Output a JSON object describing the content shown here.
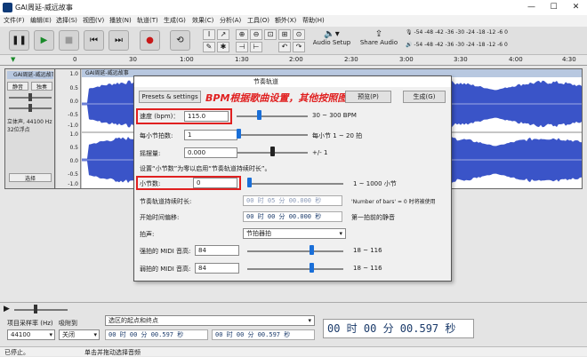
{
  "window": {
    "title": "GAI周延-威远故事"
  },
  "menu": [
    "文件(F)",
    "编辑(E)",
    "选择(S)",
    "视图(V)",
    "播放(N)",
    "轨道(T)",
    "生成(G)",
    "效果(C)",
    "分析(A)",
    "工具(O)",
    "额外(X)",
    "帮助(H)"
  ],
  "toolbar": {
    "audio_setup": "Audio Setup",
    "share_audio": "Share Audio",
    "meter_ticks": "-54 -48 -42 -36 -30 -24 -18 -12 -6 0",
    "meter_ticks2": "-54 -48 -42 -36 -30 -24 -18 -12 -6 0",
    "transport": [
      "pause",
      "play",
      "stop",
      "skip-start",
      "skip-end",
      "record",
      "loop"
    ]
  },
  "ruler": {
    "ticks": [
      "0",
      "30",
      "1:00",
      "1:30",
      "2:00",
      "2:30",
      "3:00",
      "3:30",
      "4:00",
      "4:30"
    ]
  },
  "track": {
    "name": "GAI周延-威远故事",
    "clip_name": "GAI周延-威远故事",
    "mute": "静音",
    "solo": "独奏",
    "info": "立体声, 44100 Hz\n32位浮点",
    "select": "选择",
    "scale": [
      "1.0",
      "0.5",
      "0.0",
      "-0.5",
      "-1.0",
      "1.0",
      "0.5",
      "0.0",
      "-0.5",
      "-1.0"
    ]
  },
  "dialog": {
    "title": "节奏轨道",
    "presets_label": "Presets & settings",
    "preview_label": "预览(P)",
    "generate_label": "生成(G)",
    "annotation": "BPM根据歌曲设置，其他按照图设置",
    "tempo_label": "速度 (bpm)：",
    "tempo_value": "115.0",
    "tempo_range": "30 ~ 300 BPM",
    "tempo_level": 0.3,
    "beats_label": "每小节拍数:",
    "beats_value": "1",
    "beats_range": "每小节 1 ~ 20 拍",
    "beats_level": 0.0,
    "swing_label": "摇摆量:",
    "swing_value": "0.000",
    "swing_range": "+/- 1",
    "swing_level": 0.5,
    "hint": "设置“小节数”为零以启用“节奏轨道持续时长”。",
    "bars_label": "小节数:",
    "bars_value": "0",
    "bars_range": "1 ~ 1000 小节",
    "bars_level": 0.0,
    "duration_label": "节奏轨道持续时长:",
    "duration_value": "00 时 05 分 00.000 秒",
    "duration_note": "'Number of bars' = 0 时将被使用",
    "offset_label": "开始时间偏移:",
    "offset_value": "00 时 00 分 00.000 秒",
    "offset_note": "第一拍前的静音",
    "beat_sound_label": "拍声:",
    "beat_sound_value": "节拍器拍",
    "strong_label": "强拍的 MIDI 音高:",
    "strong_value": "84",
    "strong_range": "18 ~ 116",
    "strong_level": 0.68,
    "weak_label": "弱拍的 MIDI 音高:",
    "weak_value": "84",
    "weak_range": "18 ~ 116",
    "weak_level": 0.68
  },
  "bottom": {
    "rate_label": "项目采样率 (Hz)",
    "snap_label": "吸附到",
    "rate_value": "44100",
    "snap_value": "关闭",
    "sel_label": "选区的起点和终点",
    "sel_start": "00 时 00 分 00.597 秒",
    "sel_end": "00 时 00 分 00.597 秒",
    "time_display": "00 时 00 分 00.597 秒"
  },
  "status": {
    "left": "已停止。",
    "right": "单击并拖动选择音频"
  }
}
